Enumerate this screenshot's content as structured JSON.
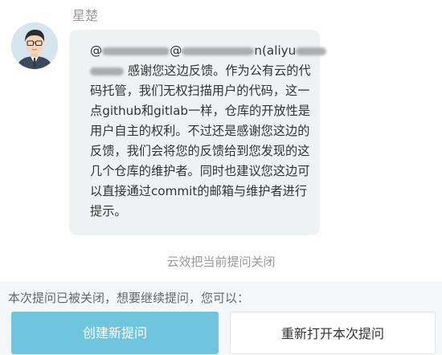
{
  "sender": {
    "name": "星楚"
  },
  "message": {
    "mention_prefix": "@",
    "mention_second_at": "@",
    "mention_visible_fragment": "n(aliyu",
    "line_1_suffix": "感谢您这边反馈。作为公有云的",
    "body": "代码托管，我们无权扫描用户的代码，这一点github和gitlab一样，仓库的开放性是用户自主的权利。不过还是感谢您这边的反馈，我们会将您的反馈给到您发现的这几个仓库的维护者。同时也建议您这边可以直接通过commit的邮箱与维护者进行提示。"
  },
  "system_note": "云效把当前提问关闭",
  "closed_panel": {
    "prompt": "本次提问已被关闭，想要继续提问，您可以：",
    "create_button": "创建新提问",
    "reopen_button": "重新打开本次提问"
  },
  "colors": {
    "primary_button": "#6fc4de",
    "bubble_background": "#eef2f2",
    "panel_background": "#f5f6f7"
  }
}
